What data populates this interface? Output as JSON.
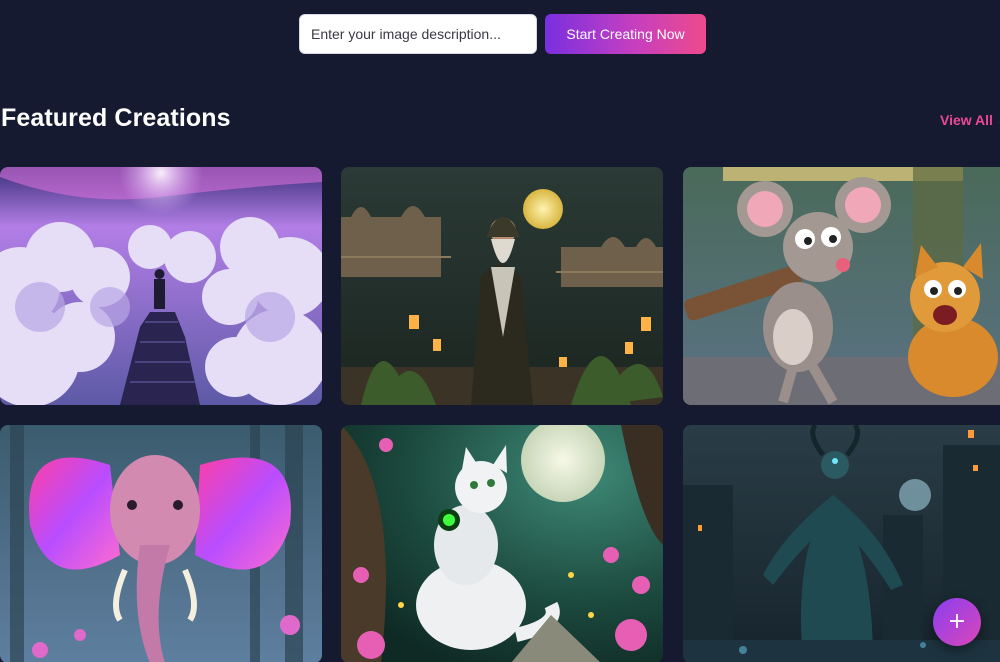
{
  "prompt": {
    "placeholder": "Enter your image description...",
    "value": "",
    "button_label": "Start Creating Now"
  },
  "featured": {
    "title": "Featured Creations",
    "view_all_label": "View All →"
  },
  "fab": {
    "icon": "plus-icon",
    "label": "+"
  },
  "colors": {
    "background": "#151a30",
    "accent_pink": "#ec4899",
    "accent_purple": "#7a2fe0"
  }
}
